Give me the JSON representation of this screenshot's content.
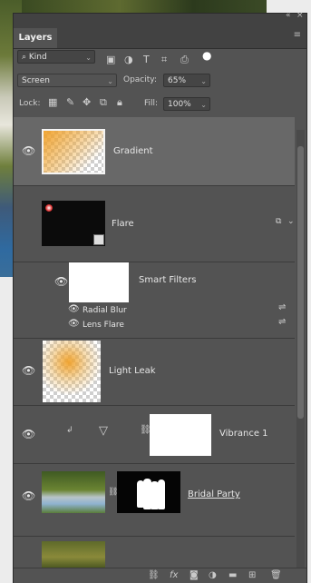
{
  "panel": {
    "title": "Layers",
    "window_controls": [
      "«",
      "×"
    ],
    "menu_icon": "panel-menu-icon"
  },
  "filter": {
    "kind_label": "Kind",
    "icons": [
      "image-filter-icon",
      "adjustment-filter-icon",
      "type-filter-icon",
      "shape-filter-icon",
      "smartobject-filter-icon",
      "filter-toggle-dot"
    ]
  },
  "blend": {
    "mode": "Screen",
    "opacity_label": "Opacity:",
    "opacity_value": "65%",
    "lock_label": "Lock:",
    "fill_label": "Fill:",
    "fill_value": "100%"
  },
  "layers": [
    {
      "name": "Gradient",
      "selected": true
    },
    {
      "name": "Flare"
    },
    {
      "name": "Smart Filters"
    },
    {
      "name": "Radial Blur"
    },
    {
      "name": "Lens Flare"
    },
    {
      "name": "Light Leak"
    },
    {
      "name": "Vibrance 1"
    },
    {
      "name": "Bridal Party"
    }
  ],
  "colors": {
    "panel_bg": "#535353",
    "selected_row": "#686868",
    "header_bg": "#424242"
  },
  "bottom_icons": [
    "link-icon",
    "fx-icon",
    "mask-icon",
    "adjustment-icon",
    "folder-icon",
    "new-layer-icon",
    "trash-icon"
  ]
}
